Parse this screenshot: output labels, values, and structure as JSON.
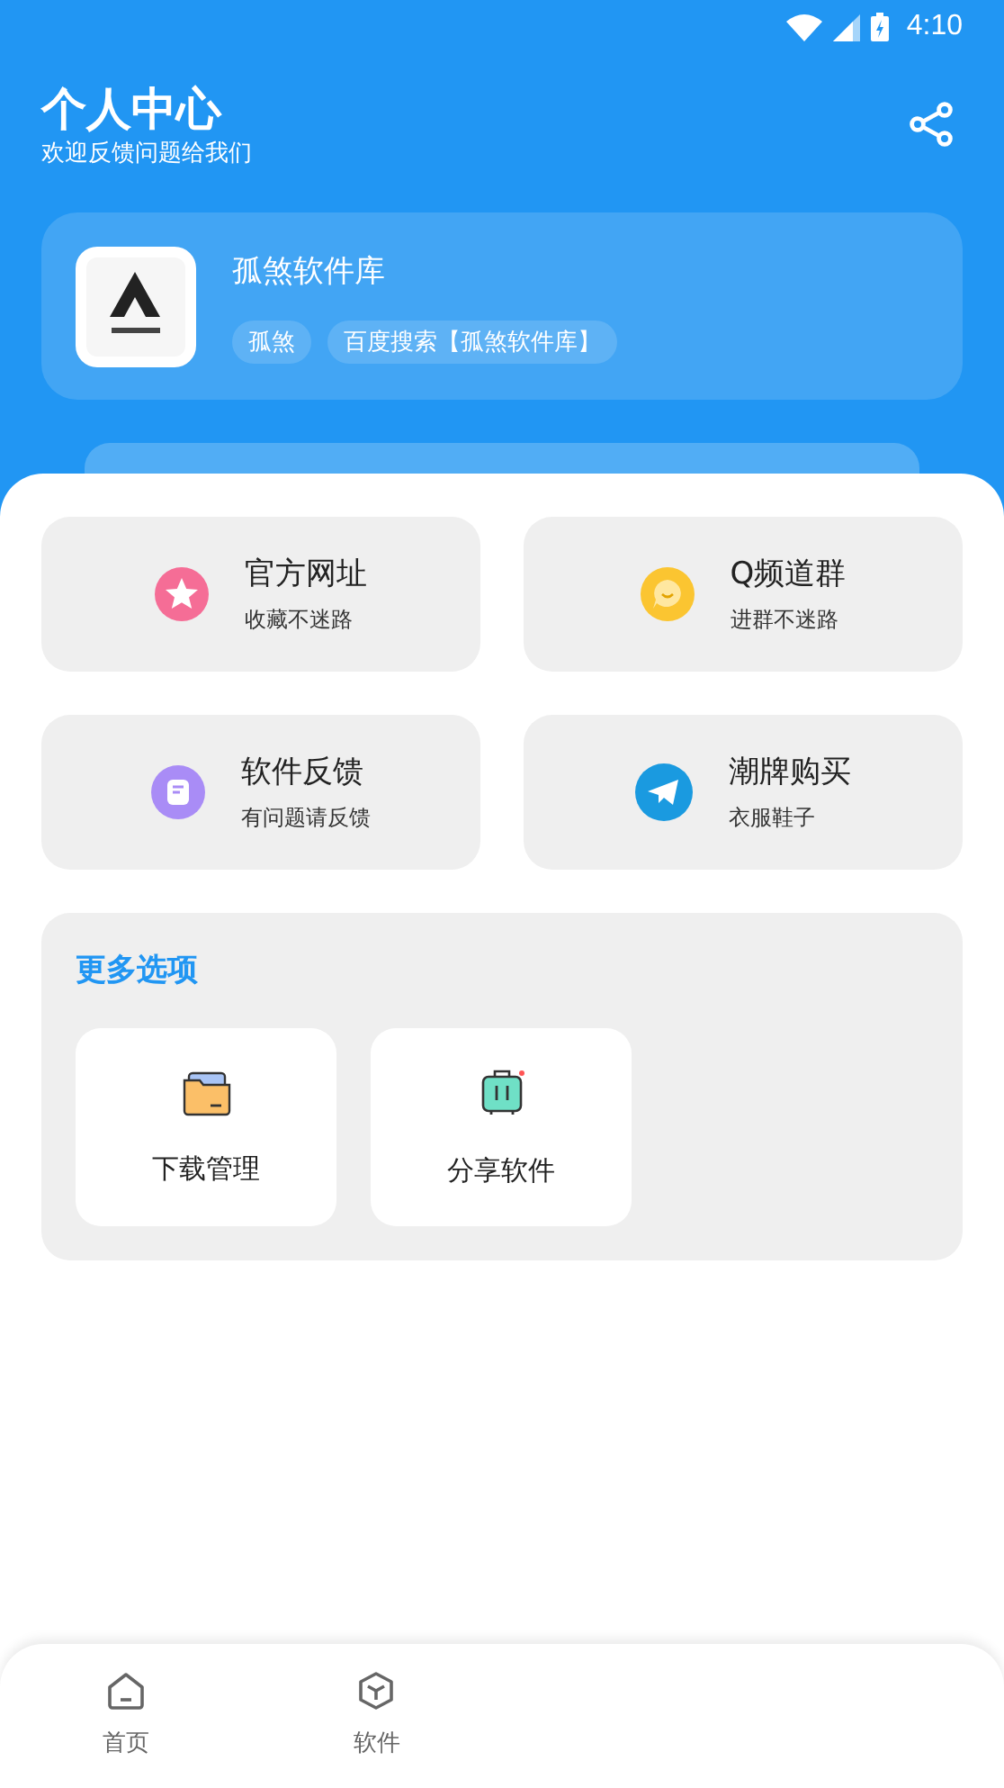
{
  "status_bar": {
    "time": "4:10"
  },
  "header": {
    "title": "个人中心",
    "subtitle": "欢迎反馈问题给我们"
  },
  "profile": {
    "name": "孤煞软件库",
    "tags": [
      "孤煞",
      "百度搜索【孤煞软件库】"
    ]
  },
  "links": [
    {
      "kind": "star",
      "title": "官方网址",
      "subtitle": "收藏不迷路"
    },
    {
      "kind": "chat",
      "title": "Q频道群",
      "subtitle": "进群不迷路"
    },
    {
      "kind": "note",
      "title": "软件反馈",
      "subtitle": "有问题请反馈"
    },
    {
      "kind": "plane",
      "title": "潮牌购买",
      "subtitle": "衣服鞋子"
    }
  ],
  "more": {
    "title": "更多选项",
    "items": [
      {
        "kind": "folder",
        "label": "下载管理"
      },
      {
        "kind": "suitcase",
        "label": "分享软件"
      }
    ]
  },
  "bottom_nav": [
    {
      "kind": "home",
      "label": "首页",
      "selected": false
    },
    {
      "kind": "cube",
      "label": "软件",
      "selected": false
    }
  ]
}
